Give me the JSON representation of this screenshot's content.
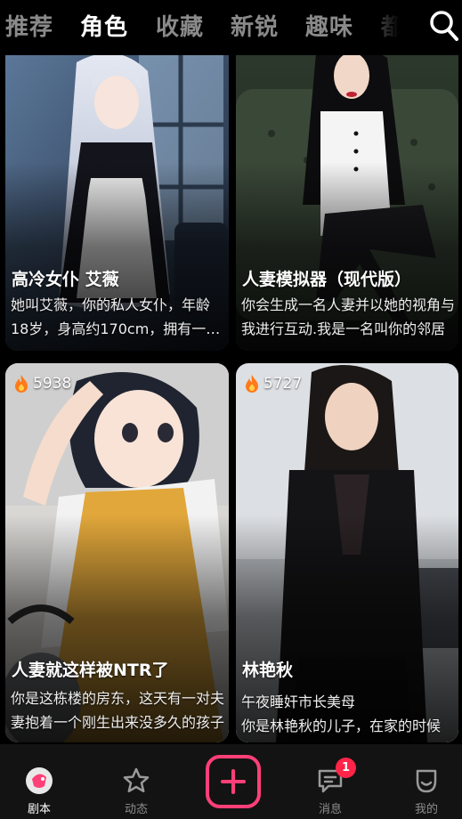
{
  "tabs": [
    {
      "label": "推荐",
      "active": false
    },
    {
      "label": "角色",
      "active": true
    },
    {
      "label": "收藏",
      "active": false
    },
    {
      "label": "新锐",
      "active": false
    },
    {
      "label": "趣味",
      "active": false
    },
    {
      "label": "都市",
      "active": false
    }
  ],
  "search_icon": "search-icon",
  "cards": [
    {
      "title": "高冷女仆 艾薇",
      "description": "她叫艾薇，你的私人女仆，年龄18岁，身高约170cm，拥有一头银色长发",
      "image": "silver-haired-maid-illustration"
    },
    {
      "title": "人妻模拟器（现代版）",
      "description": "你会生成一名人妻并以她的视角与我进行互动.我是一名叫你的邻居",
      "image": "woman-in-white-qipao-photo"
    },
    {
      "hot_count": "5938",
      "title": "人妻就这样被NTR了",
      "description": "你是这栋楼的房东，这天有一对夫妻抱着一个刚生出来没多久的孩子",
      "image": "anime-housewife-with-kettle"
    },
    {
      "hot_count": "5727",
      "title": "林艳秋",
      "line1": "午夜睡奸市长美母",
      "line2": "你是林艳秋的儿子，在家的时候",
      "image": "woman-in-black-suit-office"
    }
  ],
  "nav": [
    {
      "label": "剧本",
      "icon": "script-icon",
      "active": true
    },
    {
      "label": "动态",
      "icon": "star-icon",
      "active": false
    },
    {
      "label": "",
      "icon": "add-icon",
      "active": false
    },
    {
      "label": "消息",
      "icon": "message-icon",
      "active": false,
      "badge": "1"
    },
    {
      "label": "我的",
      "icon": "profile-icon",
      "active": false
    }
  ],
  "colors": {
    "accent": "#ff3f78",
    "badge": "#ff2448",
    "background": "#000000",
    "tab_inactive": "#8a8a8a",
    "nav_bar": "#131313"
  }
}
